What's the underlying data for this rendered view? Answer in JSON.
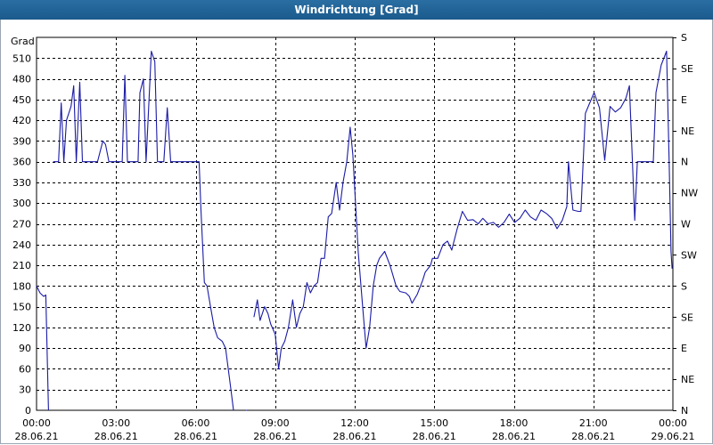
{
  "window": {
    "title": "Windrichtung [Grad]"
  },
  "colors": {
    "title_bar": "#1f5f91",
    "line": "#1a1aa6",
    "grid": "#000000"
  },
  "chart_data": {
    "type": "line",
    "title": "Windrichtung [Grad]",
    "ylabel": "Grad",
    "xlim": [
      0,
      24
    ],
    "ylim": [
      0,
      540
    ],
    "y_ticks": [
      0,
      30,
      60,
      90,
      120,
      150,
      180,
      210,
      240,
      270,
      300,
      330,
      360,
      390,
      420,
      450,
      480,
      510
    ],
    "right_axis_labels": [
      {
        "y": 0,
        "label": "N"
      },
      {
        "y": 45,
        "label": "NE"
      },
      {
        "y": 90,
        "label": "E"
      },
      {
        "y": 135,
        "label": "SE"
      },
      {
        "y": 180,
        "label": "S"
      },
      {
        "y": 225,
        "label": "SW"
      },
      {
        "y": 270,
        "label": "W"
      },
      {
        "y": 315,
        "label": "NW"
      },
      {
        "y": 360,
        "label": "N"
      },
      {
        "y": 405,
        "label": "NE"
      },
      {
        "y": 450,
        "label": "E"
      },
      {
        "y": 495,
        "label": "SE"
      },
      {
        "y": 540,
        "label": "S"
      }
    ],
    "x_ticks": [
      {
        "x": 0,
        "time": "00:00",
        "date": "28.06.21"
      },
      {
        "x": 3,
        "time": "03:00",
        "date": "28.06.21"
      },
      {
        "x": 6,
        "time": "06:00",
        "date": "28.06.21"
      },
      {
        "x": 9,
        "time": "09:00",
        "date": "28.06.21"
      },
      {
        "x": 12,
        "time": "12:00",
        "date": "28.06.21"
      },
      {
        "x": 15,
        "time": "15:00",
        "date": "28.06.21"
      },
      {
        "x": 18,
        "time": "18:00",
        "date": "28.06.21"
      },
      {
        "x": 21,
        "time": "21:00",
        "date": "28.06.21"
      },
      {
        "x": 24,
        "time": "00:00",
        "date": "29.06.21"
      }
    ],
    "grid": true,
    "series": [
      {
        "segments": [
          [
            [
              0,
              180
            ],
            [
              0.13,
              170
            ],
            [
              0.27,
              165
            ],
            [
              0.35,
              167
            ],
            [
              0.45,
              0
            ]
          ],
          [
            [
              0.63,
              360
            ],
            [
              0.83,
              360
            ],
            [
              0.93,
              445
            ],
            [
              1.03,
              360
            ],
            [
              1.13,
              420
            ],
            [
              1.3,
              440
            ],
            [
              1.4,
              470
            ],
            [
              1.5,
              360
            ],
            [
              1.63,
              475
            ],
            [
              1.73,
              360
            ],
            [
              2.03,
              360
            ],
            [
              2.3,
              360
            ],
            [
              2.5,
              390
            ],
            [
              2.6,
              385
            ],
            [
              2.73,
              360
            ],
            [
              3.03,
              360
            ],
            [
              3.23,
              360
            ],
            [
              3.33,
              485
            ],
            [
              3.43,
              360
            ],
            [
              3.63,
              360
            ],
            [
              3.83,
              360
            ],
            [
              3.9,
              460
            ],
            [
              4.03,
              480
            ],
            [
              4.13,
              360
            ],
            [
              4.33,
              520
            ],
            [
              4.46,
              505
            ],
            [
              4.56,
              360
            ],
            [
              4.7,
              360
            ],
            [
              4.8,
              360
            ],
            [
              4.93,
              438
            ],
            [
              5.06,
              360
            ],
            [
              5.23,
              360
            ],
            [
              5.6,
              360
            ],
            [
              5.8,
              360
            ],
            [
              6.0,
              360
            ],
            [
              6.13,
              360
            ],
            [
              6.2,
              290
            ],
            [
              6.33,
              185
            ],
            [
              6.43,
              180
            ],
            [
              6.56,
              150
            ],
            [
              6.7,
              120
            ],
            [
              6.83,
              105
            ],
            [
              7.0,
              100
            ],
            [
              7.13,
              90
            ],
            [
              7.23,
              60
            ],
            [
              7.33,
              30
            ],
            [
              7.43,
              0
            ]
          ],
          [
            [
              7.9,
              0
            ],
            [
              7.93,
              0
            ]
          ],
          [
            [
              8.2,
              135
            ],
            [
              8.33,
              160
            ],
            [
              8.43,
              130
            ],
            [
              8.6,
              150
            ],
            [
              8.73,
              140
            ],
            [
              8.83,
              125
            ],
            [
              9.0,
              110
            ],
            [
              9.13,
              60
            ],
            [
              9.23,
              90
            ],
            [
              9.36,
              100
            ],
            [
              9.5,
              120
            ],
            [
              9.66,
              160
            ],
            [
              9.8,
              120
            ],
            [
              9.93,
              140
            ],
            [
              10.06,
              150
            ],
            [
              10.2,
              185
            ],
            [
              10.33,
              170
            ],
            [
              10.46,
              180
            ],
            [
              10.6,
              185
            ],
            [
              10.73,
              220
            ],
            [
              10.86,
              220
            ],
            [
              11.0,
              280
            ],
            [
              11.13,
              285
            ],
            [
              11.3,
              330
            ],
            [
              11.43,
              290
            ],
            [
              11.56,
              330
            ],
            [
              11.7,
              360
            ],
            [
              11.83,
              410
            ],
            [
              11.93,
              370
            ],
            [
              12.03,
              300
            ],
            [
              12.13,
              230
            ],
            [
              12.3,
              150
            ],
            [
              12.43,
              90
            ],
            [
              12.56,
              120
            ],
            [
              12.7,
              180
            ],
            [
              12.83,
              210
            ],
            [
              12.93,
              220
            ],
            [
              13.13,
              230
            ],
            [
              13.33,
              210
            ],
            [
              13.56,
              180
            ],
            [
              13.7,
              172
            ],
            [
              13.93,
              170
            ],
            [
              14.06,
              165
            ],
            [
              14.16,
              155
            ],
            [
              14.36,
              168
            ],
            [
              14.56,
              188
            ],
            [
              14.66,
              200
            ],
            [
              14.86,
              210
            ],
            [
              14.93,
              220
            ],
            [
              15.13,
              220
            ],
            [
              15.33,
              240
            ],
            [
              15.5,
              245
            ],
            [
              15.66,
              232
            ],
            [
              15.86,
              262
            ],
            [
              16.06,
              288
            ],
            [
              16.26,
              275
            ],
            [
              16.46,
              276
            ],
            [
              16.66,
              270
            ],
            [
              16.83,
              278
            ],
            [
              17.03,
              270
            ],
            [
              17.23,
              272
            ],
            [
              17.43,
              265
            ],
            [
              17.63,
              272
            ],
            [
              17.83,
              284
            ],
            [
              18.03,
              272
            ],
            [
              18.23,
              278
            ],
            [
              18.43,
              290
            ],
            [
              18.63,
              280
            ],
            [
              18.83,
              275
            ],
            [
              19.03,
              290
            ],
            [
              19.23,
              285
            ],
            [
              19.43,
              278
            ],
            [
              19.63,
              263
            ],
            [
              19.83,
              275
            ],
            [
              20.0,
              295
            ],
            [
              20.06,
              360
            ],
            [
              20.23,
              290
            ],
            [
              20.43,
              288
            ],
            [
              20.53,
              288
            ],
            [
              20.7,
              430
            ],
            [
              20.83,
              442
            ],
            [
              21.03,
              460
            ],
            [
              21.23,
              438
            ],
            [
              21.43,
              362
            ],
            [
              21.63,
              440
            ],
            [
              21.83,
              432
            ],
            [
              22.03,
              438
            ],
            [
              22.23,
              452
            ],
            [
              22.36,
              470
            ],
            [
              22.56,
              275
            ],
            [
              22.66,
              360
            ],
            [
              22.86,
              360
            ],
            [
              23.06,
              360
            ],
            [
              23.26,
              360
            ],
            [
              23.36,
              460
            ],
            [
              23.56,
              500
            ],
            [
              23.76,
              520
            ],
            [
              23.86,
              360
            ],
            [
              23.93,
              230
            ],
            [
              23.97,
              205
            ]
          ]
        ]
      }
    ]
  }
}
